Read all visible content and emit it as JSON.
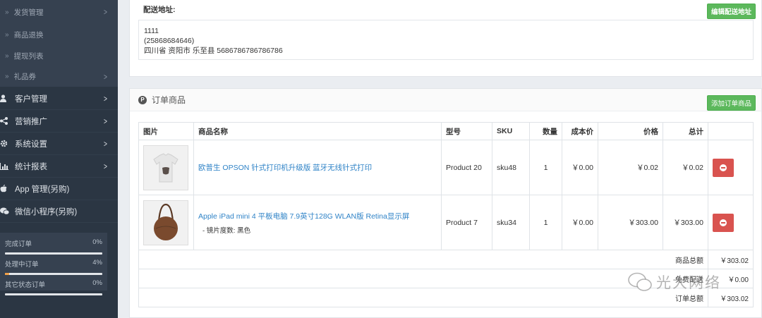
{
  "sidebar": {
    "sub_items": [
      {
        "label": "发货管理",
        "has_arrow": true
      },
      {
        "label": "商品退换",
        "has_arrow": false
      },
      {
        "label": "提现列表",
        "has_arrow": false
      },
      {
        "label": "礼品券",
        "has_arrow": true
      }
    ],
    "main_items": [
      {
        "label": "客户管理",
        "icon": "user-icon",
        "has_arrow": true
      },
      {
        "label": "营销推广",
        "icon": "share-icon",
        "has_arrow": true
      },
      {
        "label": "系统设置",
        "icon": "gear-icon",
        "has_arrow": true
      },
      {
        "label": "统计报表",
        "icon": "bar-chart-icon",
        "has_arrow": true
      },
      {
        "label": "App 管理(另购)",
        "icon": "apple-icon",
        "has_arrow": false
      },
      {
        "label": "微信小程序(另购)",
        "icon": "wechat-icon",
        "has_arrow": false
      }
    ],
    "stats": [
      {
        "label": "完成订单",
        "value": "0%",
        "progress": 0
      },
      {
        "label": "处理中订单",
        "value": "4%",
        "progress": 0.04
      },
      {
        "label": "其它状态订单",
        "value": "0%",
        "progress": 0
      }
    ]
  },
  "address": {
    "title": "配送地址:",
    "edit_button": "编辑配送地址",
    "line1": "1111",
    "line2": "(25868684646)",
    "line3": "四川省 资阳市 乐至县 5686786786786786"
  },
  "order_products": {
    "title": "订单商品",
    "title_icon": "P",
    "add_button": "添加订单商品",
    "columns": [
      "图片",
      "商品名称",
      "型号",
      "SKU",
      "数量",
      "成本价",
      "价格",
      "总计"
    ],
    "rows": [
      {
        "name": "欧普生 OPSON 针式打印机升级版 蓝牙无线针式打印",
        "option": "",
        "model": "Product 20",
        "sku": "sku48",
        "qty": "1",
        "cost": "￥0.00",
        "price": "￥0.02",
        "total": "￥0.02",
        "image": "tshirt"
      },
      {
        "name": "Apple iPad mini 4 平板电脑 7.9英寸128G WLAN版 Retina显示屏",
        "option": "- 镜片度数: 黑色",
        "model": "Product 7",
        "sku": "sku34",
        "qty": "1",
        "cost": "￥0.00",
        "price": "￥303.00",
        "total": "￥303.00",
        "image": "bag"
      }
    ],
    "summary": [
      {
        "label": "商品总额",
        "value": "￥303.02"
      },
      {
        "label": "免费配送",
        "value": "￥0.00"
      },
      {
        "label": "订单总额",
        "value": "￥303.02"
      }
    ]
  },
  "watermark": "光大网络"
}
